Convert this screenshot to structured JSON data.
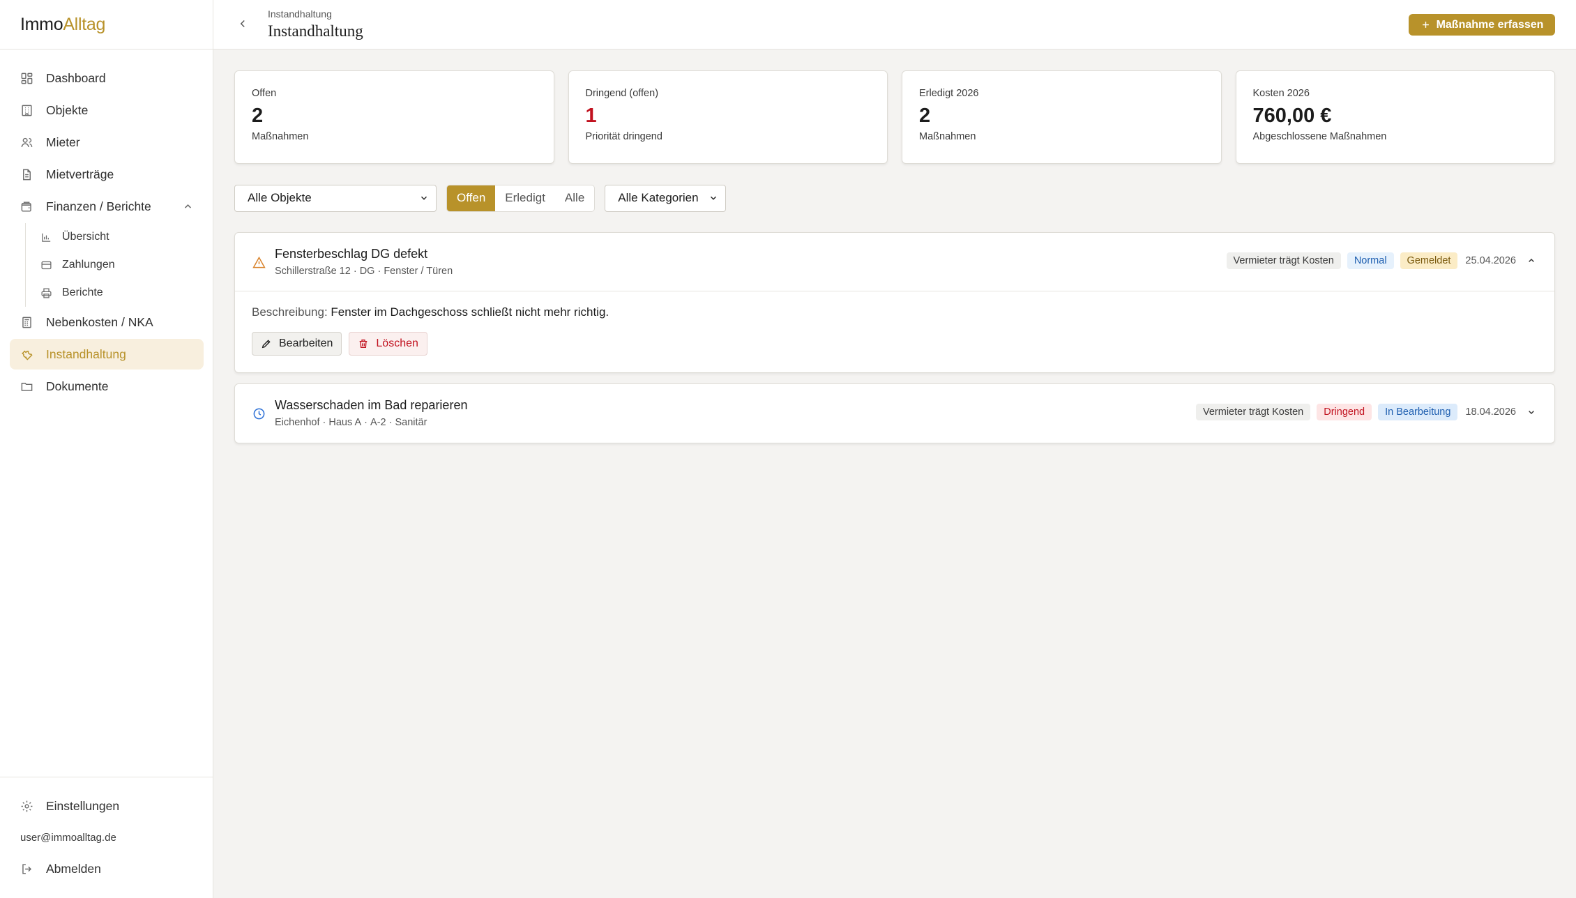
{
  "app": {
    "logo_part1": "Immo",
    "logo_part2": "Alltag"
  },
  "sidebar": {
    "items": [
      {
        "label": "Dashboard",
        "icon": "dashboard-icon"
      },
      {
        "label": "Objekte",
        "icon": "building-icon"
      },
      {
        "label": "Mieter",
        "icon": "users-icon"
      },
      {
        "label": "Mietverträge",
        "icon": "document-icon"
      },
      {
        "label": "Finanzen / Berichte",
        "icon": "wallet-icon",
        "expanded": true
      },
      {
        "label": "Nebenkosten / NKA",
        "icon": "calculator-icon"
      },
      {
        "label": "Instandhaltung",
        "icon": "wrench-icon",
        "active": true
      },
      {
        "label": "Dokumente",
        "icon": "folder-icon"
      }
    ],
    "sub_items": [
      {
        "label": "Übersicht",
        "icon": "bar-chart-icon"
      },
      {
        "label": "Zahlungen",
        "icon": "credit-card-icon"
      },
      {
        "label": "Berichte",
        "icon": "printer-icon"
      }
    ],
    "settings_label": "Einstellungen",
    "user_email": "user@immoalltag.de",
    "logout_label": "Abmelden"
  },
  "header": {
    "breadcrumb": "Instandhaltung",
    "title": "Instandhaltung",
    "primary_button": "Maßnahme erfassen"
  },
  "stats": [
    {
      "label": "Offen",
      "value": "2",
      "sub": "Maßnahmen"
    },
    {
      "label": "Dringend (offen)",
      "value": "1",
      "sub": "Priorität dringend"
    },
    {
      "label": "Erledigt 2026",
      "value": "2",
      "sub": "Maßnahmen"
    },
    {
      "label": "Kosten 2026",
      "value": "760,00 €",
      "sub": "Abgeschlossene Maßnahmen"
    }
  ],
  "filters": {
    "object_select": "Alle Objekte",
    "status_tabs": [
      "Offen",
      "Erledigt",
      "Alle"
    ],
    "status_active": "Offen",
    "category_select": "Alle Kategorien"
  },
  "items": [
    {
      "title": "Fensterbeschlag DG defekt",
      "meta": [
        "Schillerstraße 12",
        "DG",
        "Fenster / Türen"
      ],
      "cost_badge": "Vermieter trägt Kosten",
      "priority": "Normal",
      "status": "Gemeldet",
      "date": "25.04.2026",
      "expanded": true,
      "description_label": "Beschreibung:",
      "description": "Fenster im Dachgeschoss schließt nicht mehr richtig.",
      "edit_label": "Bearbeiten",
      "delete_label": "Löschen"
    },
    {
      "title": "Wasserschaden im Bad reparieren",
      "meta": [
        "Eichenhof",
        "Haus A",
        "A-2",
        "Sanitär"
      ],
      "cost_badge": "Vermieter trägt Kosten",
      "priority": "Dringend",
      "status": "In Bearbeitung",
      "date": "18.04.2026",
      "expanded": false
    }
  ],
  "colors": {
    "accent": "#b8922a",
    "urgent": "#c1121f",
    "active_nav_bg": "#f8efde"
  }
}
